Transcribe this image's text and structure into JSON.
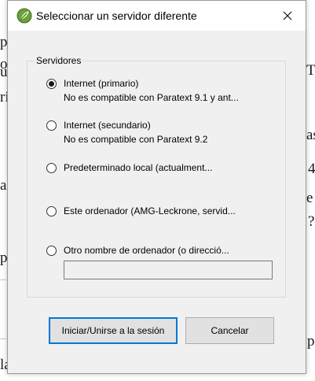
{
  "background": {
    "fragments": [
      "p",
      "o",
      "u",
      "ri",
      "a",
      "la",
      "as",
      "4",
      "e",
      "?",
      "T",
      "p",
      "p"
    ]
  },
  "dialog": {
    "title": "Seleccionar un servidor diferente",
    "group_label": "Servidores",
    "options": [
      {
        "label": "Internet (primario)",
        "sublabel": "No es compatible con Paratext 9.1 y ant...",
        "checked": true
      },
      {
        "label": "Internet (secundario)",
        "sublabel": "No es compatible con Paratext 9.2",
        "checked": false
      },
      {
        "label": "Predeterminado local (actualment...",
        "checked": false
      },
      {
        "label": "Este ordenador (AMG-Leckrone, servid...",
        "checked": false
      },
      {
        "label": "Otro nombre de ordenador (o direcció...",
        "checked": false
      }
    ],
    "other_input_value": "",
    "start_button": "Iniciar/Unirse a la sesión",
    "cancel_button": "Cancelar"
  },
  "colors": {
    "focus_border": "#0078d7",
    "dialog_bg": "#f0f0f0",
    "app_icon_green": "#6a9f3a"
  },
  "icons": {
    "app": "paratext-leaf-icon",
    "close": "close-icon"
  }
}
